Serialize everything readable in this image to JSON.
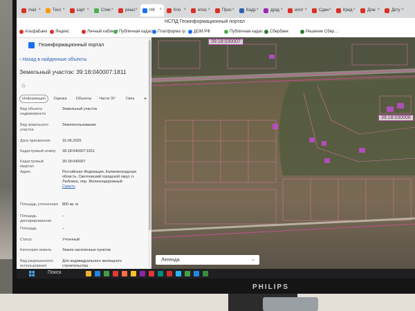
{
  "browser": {
    "tabs": [
      {
        "label": "mail",
        "color": "#d93025"
      },
      {
        "label": "Тесс",
        "color": "#ff9800"
      },
      {
        "label": "карт",
        "color": "#d93025"
      },
      {
        "label": "Спис",
        "color": "#4caf50"
      },
      {
        "label": "решс",
        "color": "#d93025"
      },
      {
        "label": "НК",
        "color": "#1c6ff0",
        "active": true
      },
      {
        "label": "Кло",
        "color": "#d93025"
      },
      {
        "label": "ипос",
        "color": "#d93025"
      },
      {
        "label": "Прос",
        "color": "#d93025"
      },
      {
        "label": "Кадр",
        "color": "#2c63b5"
      },
      {
        "label": "дрзд",
        "color": "#9c27b0"
      },
      {
        "label": "ипот",
        "color": "#d93025"
      },
      {
        "label": "Сден",
        "color": "#d93025"
      },
      {
        "label": "Кред",
        "color": "#d93025"
      },
      {
        "label": "Дом",
        "color": "#d93025"
      },
      {
        "label": "Дкту",
        "color": "#d93025"
      }
    ],
    "address": "НСПД Геоинформационный портал",
    "bookmarks": [
      {
        "label": "АльфаБанк",
        "color": "#d93025"
      },
      {
        "label": "Яндекс",
        "color": "#d93025"
      },
      {
        "label": "Личный кабинет",
        "color": "#d93025"
      },
      {
        "label": "Публичная кадаст…",
        "color": "#4caf50"
      },
      {
        "label": "Платформа гр",
        "color": "#1c6ff0"
      },
      {
        "label": "ДОМ.РФ",
        "color": "#1c6ff0"
      },
      {
        "label": "Публичная кадас",
        "color": "#4caf50"
      },
      {
        "label": "Сбербанк",
        "color": "#2e7d32"
      },
      {
        "label": "Решение Сбер…",
        "color": "#2e7d32"
      }
    ]
  },
  "panel": {
    "portal_title": "Геоинформационный портал",
    "back_link": "Назад в найденные объекты",
    "parcel_title": "Земельный участок: 39:18:040007:1811",
    "tabs": [
      "Информация",
      "Оценка",
      "Объекты",
      "Части ЗУ",
      "Связ"
    ],
    "fields": [
      {
        "key": "Вид объекта недвижимости",
        "value": "Земельный участок"
      },
      {
        "key": "Вид земельного участка",
        "value": "Землепользование"
      },
      {
        "key": "Дата присвоения",
        "value": "16.06.2025"
      },
      {
        "key": "Кадастровый номер",
        "value": "39:18:040007:1811"
      },
      {
        "key": "Кадастровый квартал",
        "value": "39:18:040007"
      },
      {
        "key": "Адрес",
        "value": "Российская Федерация, Калининградская область, Светловский городской округ, п. Люблино, пер. Железнодорожный",
        "link": "Скрыть"
      },
      {
        "key": "Площадь уточненная",
        "value": "800 кв. м"
      },
      {
        "key": "Площадь декларированная",
        "value": "–"
      },
      {
        "key": "Площадь",
        "value": "–"
      },
      {
        "key": "Статус",
        "value": "Учтенный"
      },
      {
        "key": "Категория земель",
        "value": "Земли населенных пунктов"
      },
      {
        "key": "Вид разрешенного использования",
        "value": "Для индивидуального жилищного строительства"
      }
    ]
  },
  "map": {
    "labels": [
      "39:18:030007",
      "39:18:030008"
    ],
    "legend": "Легенда"
  },
  "taskbar": {
    "search": "Поиск",
    "icons": [
      "#f2b233",
      "#1e88e5",
      "#43a047",
      "#e53935",
      "#ff7043",
      "#fbc02d",
      "#8e24aa",
      "#e53935",
      "#00897b",
      "#d32f2f",
      "#29b6f6",
      "#43a047",
      "#1e88e5",
      "#388e3c"
    ]
  },
  "monitor": {
    "brand": "PHILIPS"
  }
}
